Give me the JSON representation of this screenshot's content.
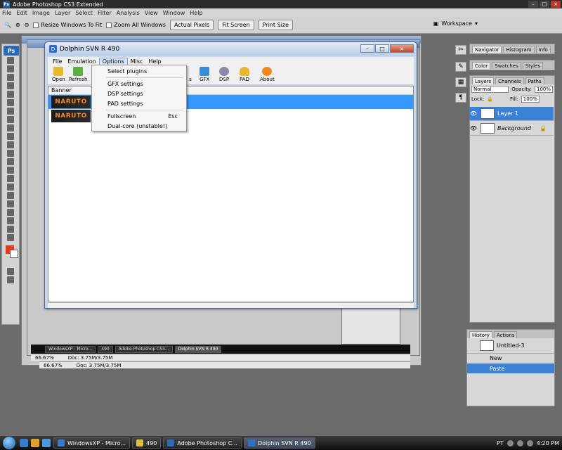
{
  "photoshop": {
    "title": "Adobe Photoshop CS3 Extended",
    "logo": "Ps",
    "menu": [
      "File",
      "Edit",
      "Image",
      "Layer",
      "Select",
      "Filter",
      "Analysis",
      "View",
      "Window",
      "Help"
    ],
    "options": {
      "resize_windows": "Resize Windows To Fit",
      "zoom_all": "Zoom All Windows",
      "actual_pixels": "Actual Pixels",
      "fit_screen": "Fit Screen",
      "print_size": "Print Size",
      "workspace": "Workspace"
    },
    "status": {
      "zoom1": "66.67%",
      "doc1": "Doc: 3.75M/3.75M",
      "zoom2": "66.67%",
      "doc2": "Doc: 3.75M/3.75M"
    },
    "panels": {
      "nav_tabs": [
        "Navigator",
        "Histogram",
        "Info"
      ],
      "color_tabs": [
        "Color",
        "Swatches",
        "Styles"
      ],
      "layer_tabs": [
        "Layers",
        "Channels",
        "Paths"
      ],
      "blend_mode": "Normal",
      "opacity_label": "Opacity:",
      "opacity_value": "100%",
      "lock_label": "Lock:",
      "fill_label": "Fill:",
      "fill_value": "100%",
      "layers": [
        "Layer 1",
        "Background"
      ],
      "history_tabs": [
        "History",
        "Actions"
      ],
      "history_doc": "Untitled-3",
      "history_items": [
        "New",
        "Paste"
      ]
    }
  },
  "dolphin": {
    "title": "Dolphin SVN R 490",
    "logo": "D",
    "menu": [
      "File",
      "Emulation",
      "Options",
      "Misc",
      "Help"
    ],
    "toolbar": {
      "open": "Open",
      "refresh": "Refresh",
      "b": "B",
      "s": "s",
      "gfx": "GFX",
      "dsp": "DSP",
      "pad": "PAD",
      "about": "About"
    },
    "list_header": "Banner",
    "banner_text": "NARUTO",
    "options_menu": {
      "select_plugins": "Select plugins",
      "gfx_settings": "GFX settings",
      "dsp_settings": "DSP settings",
      "pad_settings": "PAD settings",
      "fullscreen": "Fullscreen",
      "fullscreen_shortcut": "Esc",
      "dual_core": "Dual-core (unstable!)"
    }
  },
  "inner_taskbar": [
    "WindowsXP - Micro...",
    "490",
    "Adobe Photoshop CS3...",
    "Dolphin SVN R 490"
  ],
  "taskbar": {
    "tasks": [
      "WindowsXP - Micro...",
      "490",
      "Adobe Photoshop C...",
      "Dolphin SVN R 490"
    ],
    "lang": "PT",
    "time": "4:20 PM"
  },
  "colors": {
    "selection": "#3399ff",
    "layer_selection": "#3b82d6",
    "foreground_swatch": "#e63a10"
  }
}
